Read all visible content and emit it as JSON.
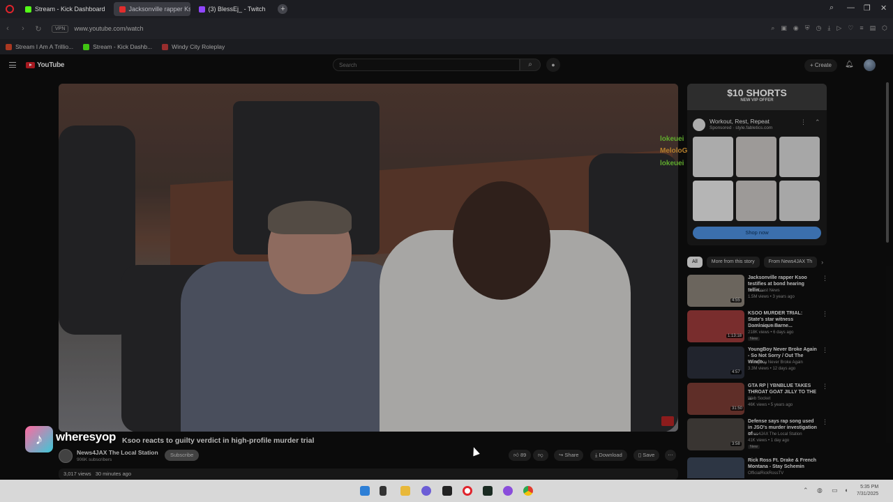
{
  "browser": {
    "tabs": [
      {
        "label": "Stream - Kick Dashboard",
        "color": "#53fc18",
        "active": false
      },
      {
        "label": "Jacksonville rapper Ks",
        "color": "#e22d2d",
        "active": true
      },
      {
        "label": "(3) BlessEj_ - Twitch",
        "color": "#9146ff",
        "active": false
      }
    ],
    "new_tab": "+",
    "vpn": "VPN",
    "url": "www.youtube.com/watch",
    "bookmarks": [
      {
        "label": "Stream I Am A Trillio...",
        "color": "#d9482b"
      },
      {
        "label": "Stream - Kick Dashb...",
        "color": "#53fc18"
      },
      {
        "label": "Windy City Roleplay",
        "color": "#c23a3a"
      }
    ]
  },
  "youtube": {
    "logo": "YouTube",
    "search_placeholder": "Search",
    "create_label": "Create",
    "video": {
      "title": "Ksoo reacts to guilty verdict in high-profile murder trial",
      "channel": "News4JAX The Local Station",
      "subscribers": "906K subscribers",
      "subscribe_label": "Subscribe",
      "views": "3,017 views",
      "time_ago": "30 minutes ago",
      "actions": {
        "share": "Share",
        "download": "Download",
        "save": "Save",
        "likes": "89"
      }
    },
    "chat": [
      {
        "user": "lokeuei",
        "color": "#7bdc3a"
      },
      {
        "user": "MeloloGang",
        "color": "#e8a33a"
      },
      {
        "user": "lokeuei",
        "color": "#7bdc3a"
      }
    ],
    "ad": {
      "banner_title": "$10 SHORTS",
      "banner_sub": "NEW VIP OFFER",
      "title": "Workout, Rest, Repeat",
      "sponsored": "Sponsored · style.fabletics.com",
      "cta": "Shop now"
    },
    "chips": [
      {
        "label": "All",
        "active": true
      },
      {
        "label": "More from this story",
        "active": false
      },
      {
        "label": "From News4JAX Th",
        "active": false
      }
    ],
    "recommendations": [
      {
        "title": "Jacksonville rapper Ksoo testifies at bond hearing tellin...",
        "channel": "First Coast News",
        "meta": "1.5M views • 3 years ago",
        "duration": "4:55",
        "new": ""
      },
      {
        "title": "KSOO MURDER TRIAL: State's star witness Dominique Barne...",
        "channel": "First Coast News",
        "meta": "218K views • 6 days ago",
        "duration": "1:13:18",
        "new": "New"
      },
      {
        "title": "YoungBoy Never Broke Again - So Not Sorry / Out The Windo...",
        "channel": "YoungBoy Never Broke Again",
        "meta": "3.3M views • 12 days ago",
        "duration": "4:57",
        "new": ""
      },
      {
        "title": "GTA RP | YBNBLUE TAKES THROAT GOAT JILLY TO THE ...",
        "channel": "Web Socket",
        "meta": "46K views • 5 years ago",
        "duration": "31:50",
        "new": ""
      },
      {
        "title": "Defense says rap song used in JSO's murder investigation of ...",
        "channel": "News4JAX The Local Station",
        "meta": "41K views • 1 day ago",
        "duration": "3:58",
        "new": "New"
      },
      {
        "title": "Rick Ross Ft. Drake & French Montana - Stay Schemin",
        "channel": "OfficialRickRossTV",
        "meta": "",
        "duration": "",
        "new": ""
      }
    ]
  },
  "overlay": {
    "tiktok_handle": "wheresyop"
  },
  "taskbar": {
    "time": "5:35 PM",
    "date": "7/31/2025"
  }
}
